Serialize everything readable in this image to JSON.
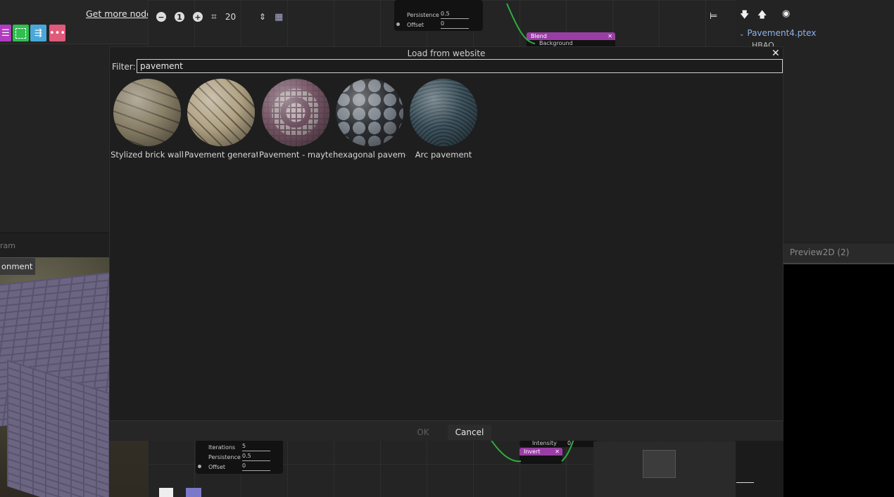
{
  "library": {
    "get_more_nodes": "Get more nodes"
  },
  "graph_toolbar": {
    "zoom_value": "20"
  },
  "nodes": {
    "top_params": [
      {
        "label": "Persistence",
        "value": "0.5"
      },
      {
        "label": "Offset",
        "value": "0"
      }
    ],
    "bottom_params": [
      {
        "label": "Iterations",
        "value": "5"
      },
      {
        "label": "Persistence",
        "value": "0.5"
      },
      {
        "label": "Offset",
        "value": "0"
      }
    ],
    "blend_title": "Blend",
    "blend_input": "Background",
    "invert_title": "Invert",
    "intensity_label": "Intensity",
    "intensity_value": "0"
  },
  "hierarchy": {
    "item": "Pavement4.ptex",
    "subitem": "HBAO"
  },
  "panels": {
    "preview2d_tab": "Preview2D (2)",
    "tab_3d": "ram",
    "environment_button": "onment"
  },
  "dialog": {
    "title": "Load from website",
    "filter_label": "Filter:",
    "filter_value": "pavement",
    "items": [
      {
        "label": "Stylized brick wall"
      },
      {
        "label": "Pavement generat"
      },
      {
        "label": "Pavement - mayter"
      },
      {
        "label": "hexagonal paveme"
      },
      {
        "label": "Arc pavement"
      }
    ],
    "ok_label": "OK",
    "cancel_label": "Cancel"
  },
  "colors": {
    "accent_purple": "#9a3ea6",
    "library_magenta": "#b03cbf",
    "library_green": "#2fbf4f",
    "library_blue": "#4aa8d8",
    "library_pink": "#e05a7a",
    "tree_item": "#8fb3e8"
  }
}
